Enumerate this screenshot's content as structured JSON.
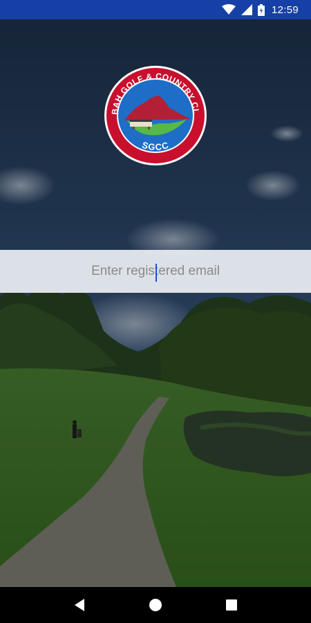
{
  "status_bar": {
    "time": "12:59",
    "icons": [
      "wifi-icon",
      "signal-icon",
      "battery-icon"
    ]
  },
  "logo": {
    "ring_text_top": "SABAH GOLF & COUNTRY CLUB",
    "ring_text_bottom": "SGCC",
    "colors": {
      "ring": "#c8102e",
      "inner": "#1e6ec8",
      "mountain": "#b32035"
    }
  },
  "login": {
    "email_placeholder": "Enter registered email",
    "email_value": ""
  },
  "nav_bar": {
    "buttons": [
      "back-icon",
      "home-icon",
      "recents-icon"
    ]
  },
  "colors": {
    "status_bar": "#1640a5",
    "caret": "#1a4fd0",
    "nav_bar": "#000000"
  }
}
